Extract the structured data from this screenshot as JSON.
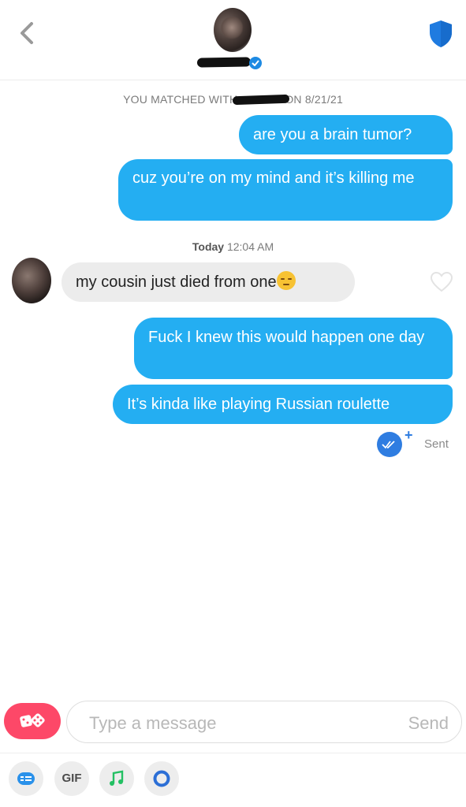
{
  "header": {
    "back_icon": "chevron-left-icon",
    "verified_icon": "verified-badge-icon",
    "shield_icon": "shield-icon"
  },
  "match": {
    "prefix": "YOU MATCHED WITH",
    "suffix": "ON 8/21/21"
  },
  "messages": [
    {
      "from": "me",
      "text": "are you a brain tumor?"
    },
    {
      "from": "me",
      "text": "cuz you’re on my mind and it’s killing me"
    },
    {
      "from": "them",
      "text": "my cousin just died from one"
    },
    {
      "from": "me",
      "text": "Fuck I knew this would happen one day"
    },
    {
      "from": "me",
      "text": "It’s kinda like playing Russian roulette"
    }
  ],
  "timestamp": {
    "day": "Today",
    "time": "12:04 AM"
  },
  "status": {
    "sent_label": "Sent",
    "plus": "+"
  },
  "composer": {
    "placeholder": "Type a message",
    "send_label": "Send"
  },
  "toolbar": {
    "gif_label": "GIF"
  },
  "colors": {
    "outgoing": "#24aef2",
    "incoming": "#ececec",
    "accent": "#fd4868",
    "verified": "#1d8ae3"
  }
}
